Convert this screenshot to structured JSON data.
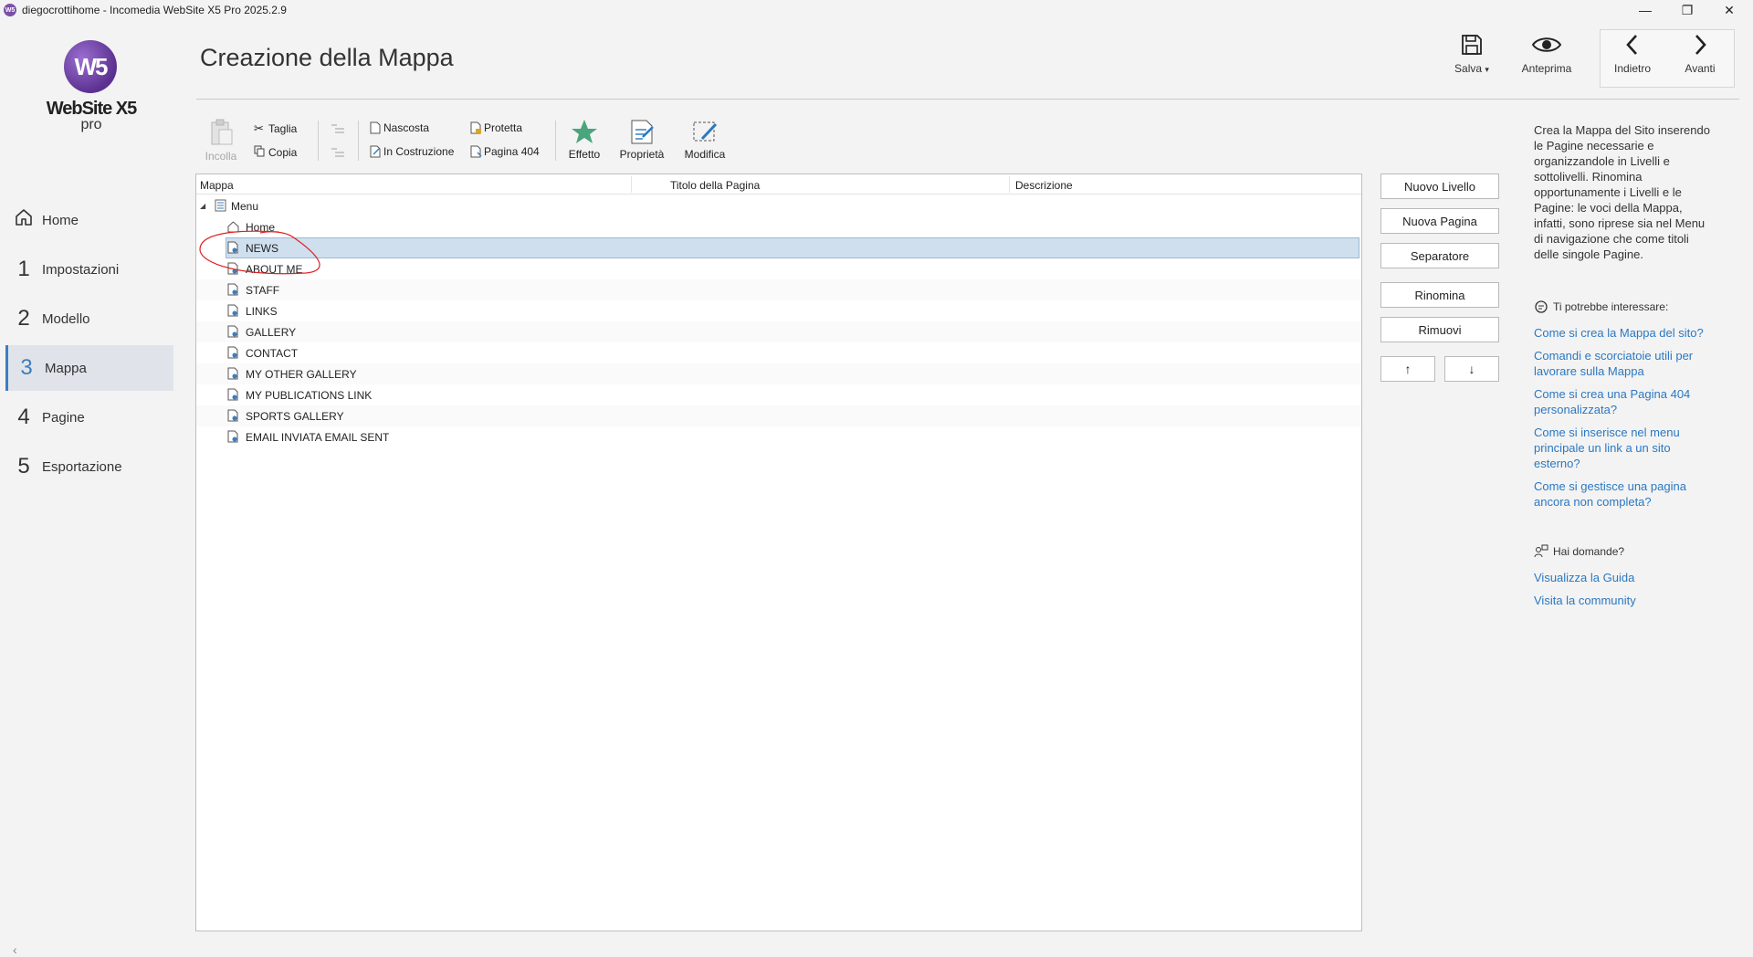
{
  "window": {
    "title": "diegocrottihome - Incomedia WebSite X5 Pro 2025.2.9",
    "app_icon": "W5",
    "controls": {
      "minimize": "—",
      "restore": "❐",
      "close": "✕"
    }
  },
  "logo": {
    "mark": "W5",
    "name": "WebSite X5",
    "edition": "pro"
  },
  "sidebar": {
    "items": [
      {
        "num": "",
        "label": "Home",
        "icon": "home-icon"
      },
      {
        "num": "1",
        "label": "Impostazioni"
      },
      {
        "num": "2",
        "label": "Modello"
      },
      {
        "num": "3",
        "label": "Mappa",
        "active": true
      },
      {
        "num": "4",
        "label": "Pagine"
      },
      {
        "num": "5",
        "label": "Esportazione"
      }
    ],
    "collapse": "‹"
  },
  "header": {
    "title": "Creazione della Mappa",
    "save_label": "Salva",
    "save_caret": "▾",
    "preview_label": "Anteprima",
    "back_label": "Indietro",
    "forward_label": "Avanti"
  },
  "toolbar": {
    "paste": "Incolla",
    "cut": "Taglia",
    "copy": "Copia",
    "hidden": "Nascosta",
    "under_construction": "In Costruzione",
    "protected": "Protetta",
    "page404": "Pagina 404",
    "effect": "Effetto",
    "properties": "Proprietà",
    "edit": "Modifica"
  },
  "tree": {
    "columns": [
      "Mappa",
      "Titolo della Pagina",
      "Descrizione"
    ],
    "root": "Menu",
    "expander": "◢",
    "rows": [
      "Home",
      "NEWS",
      "ABOUT ME",
      "STAFF",
      "LINKS",
      "GALLERY",
      "CONTACT",
      "MY OTHER GALLERY",
      "MY PUBLICATIONS LINK",
      "SPORTS GALLERY",
      "EMAIL INVIATA EMAIL SENT"
    ],
    "selected_row": "NEWS"
  },
  "actions": {
    "new_level": "Nuovo Livello",
    "new_page": "Nuova Pagina",
    "separator": "Separatore",
    "rename": "Rinomina",
    "remove": "Rimuovi",
    "up": "↑",
    "down": "↓"
  },
  "help": {
    "intro": "Crea la Mappa del Sito inserendo le Pagine necessarie e organizzandole in Livelli e sottolivelli. Rinomina opportunamente i Livelli e le Pagine: le voci della Mappa, infatti, sono riprese sia nel Menu di navigazione che come titoli delle singole Pagine.",
    "interest_heading": "Ti potrebbe interessare:",
    "links": [
      "Come si crea la Mappa del sito?",
      "Comandi e scorciatoie utili per lavorare sulla Mappa",
      "Come si crea una Pagina 404 personalizzata?",
      "Come si inserisce nel menu principale un link a un sito esterno?",
      "Come si gestisce una pagina ancora non completa?"
    ],
    "questions_heading": "Hai domande?",
    "guide_link": "Visualizza la Guida",
    "community_link": "Visita la community"
  },
  "colors": {
    "accent": "#3a7ebf",
    "link": "#2b78c2",
    "selection": "#cfdfee",
    "annotation": "#e02020"
  }
}
